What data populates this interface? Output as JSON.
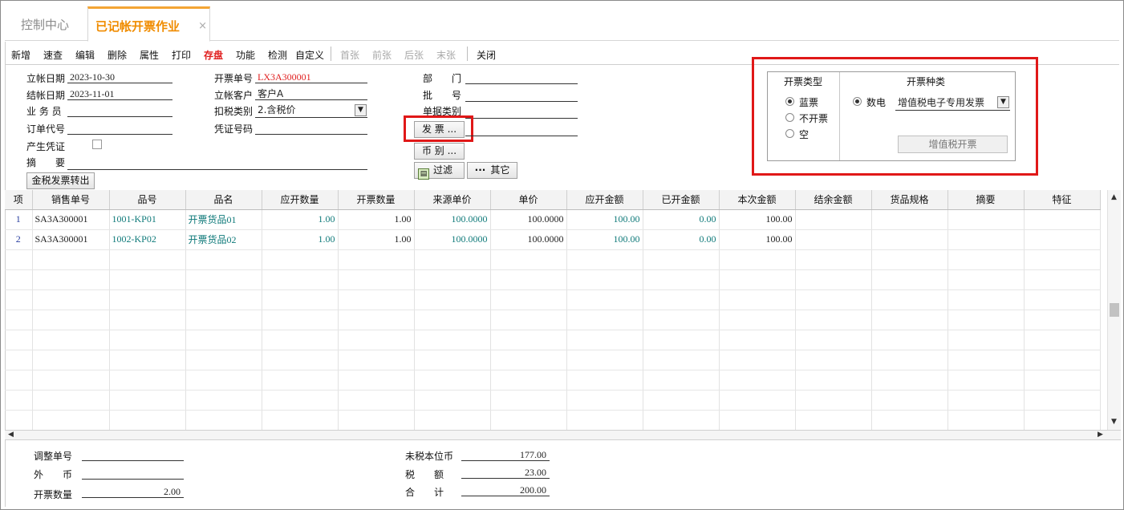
{
  "tabs": [
    {
      "label": "控制中心"
    },
    {
      "label": "已记帐开票作业",
      "close": "×"
    }
  ],
  "toolbar": {
    "items": [
      "新增",
      "速查",
      "编辑",
      "删除",
      "属性",
      "打印",
      "存盘",
      "功能",
      "检测",
      "自定义",
      "首张",
      "前张",
      "后张",
      "末张",
      "关闭"
    ]
  },
  "form": {
    "ledger_date_label": "立帐日期",
    "ledger_date": "2023-10-30",
    "close_date_label": "结帐日期",
    "close_date": "2023-11-01",
    "salesman_label": "业 务 员",
    "salesman": "",
    "order_code_label": "订单代号",
    "order_code": "",
    "voucher_label": "产生凭证",
    "summary_label": "摘　　要",
    "summary": "",
    "golden_tax_button": "金税发票转出",
    "invoice_no_label": "开票单号",
    "invoice_no": "LX3A300001",
    "customer_label": "立帐客户",
    "customer": "客户A",
    "tax_type_label": "扣税类别",
    "tax_type": "2.含税价",
    "voucher_no_label": "凭证号码",
    "voucher_no": "",
    "dept_label": "部　　门",
    "dept": "",
    "batch_label": "批　　号",
    "batch": "",
    "doc_type_label": "单据类别",
    "doc_type": "",
    "invoice_button": "发 票 ...",
    "invoice_value": "",
    "currency_button": "币 别 ...",
    "filter_button": "过滤",
    "other_button": "其它",
    "other_dots": "···"
  },
  "invoice_panel": {
    "type_title": "开票类型",
    "kind_title": "开票种类",
    "options": [
      "蓝票",
      "不开票",
      "空"
    ],
    "selected_option": "蓝票",
    "digital_label": "数电",
    "kind_value": "增值税电子专用发票",
    "vat_button": "增值税开票"
  },
  "grid": {
    "columns": [
      "项",
      "销售单号",
      "品号",
      "品名",
      "应开数量",
      "开票数量",
      "来源单价",
      "单价",
      "应开金额",
      "已开金额",
      "本次金额",
      "结余金额",
      "货品规格",
      "摘要",
      "特征"
    ],
    "rows": [
      {
        "idx": "1",
        "sale_no": "SA3A300001",
        "item_no": "1001-KP01",
        "item_name": "开票货品01",
        "due_qty": "1.00",
        "inv_qty": "1.00",
        "src_price": "100.0000",
        "price": "100.0000",
        "due_amt": "100.00",
        "done_amt": "0.00",
        "cur_amt": "100.00"
      },
      {
        "idx": "2",
        "sale_no": "SA3A300001",
        "item_no": "1002-KP02",
        "item_name": "开票货品02",
        "due_qty": "1.00",
        "inv_qty": "1.00",
        "src_price": "100.0000",
        "price": "100.0000",
        "due_amt": "100.00",
        "done_amt": "0.00",
        "cur_amt": "100.00"
      }
    ]
  },
  "footer": {
    "adjust_label": "调整单号",
    "adjust": "",
    "foreign_label": "外　　币",
    "foreign": "",
    "inv_qty_label": "开票数量",
    "inv_qty": "2.00",
    "net_label": "未税本位币",
    "net": "177.00",
    "tax_label": "税　　额",
    "tax": "23.00",
    "total_label": "合　　计",
    "total": "200.00"
  }
}
